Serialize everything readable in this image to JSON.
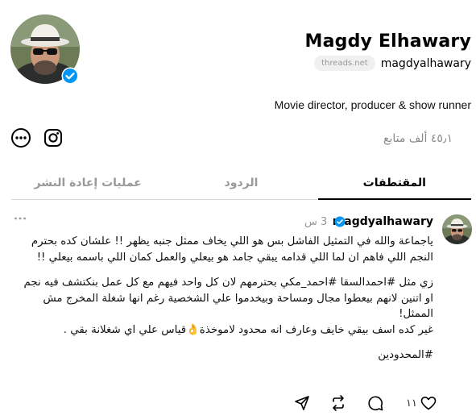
{
  "profile": {
    "name": "Magdy Elhawary",
    "handle": "magdyalhawary",
    "domain_pill": "threads.net",
    "bio": "Movie director, producer & show runner",
    "followers": "٤٥٫١ ألف متابع"
  },
  "tabs": [
    {
      "label": "المقتطفات",
      "active": true
    },
    {
      "label": "الردود",
      "active": false
    },
    {
      "label": "عمليات إعادة النشر",
      "active": false
    }
  ],
  "post": {
    "username": "magdyalhawary",
    "time": "3 س",
    "paragraph_1": "ياجماعة والله في التمثيل الفاشل بس هو اللي يخاف ممثل جنبه يظهر !! علشان كده بحترم النجم اللي فاهم ان لما اللي قدامه يبقي جامد هو بيعلي والعمل كمان اللي باسمه بيعلي !!",
    "paragraph_2": "زي مثل #احمدالسقا #احمد_مكي بحترمهم لان كل واحد فيهم مع كل عمل بنكتشف فيه نجم او اتنين لانهم بيعطوا مجال ومساحة وبيخدموا علي الشخصية رغم انها شغلة المخرج مش الممثل!\nغير كده اسف بيقي خايف وعارف انه محدود لاموخذة👌قياس علي اي شغلانة بقي .",
    "paragraph_3": "#المحدودين",
    "likes": "١١"
  },
  "icons": {
    "threads": "at-sign-icon",
    "instagram": "instagram-icon",
    "more": "more-horizontal-icon",
    "like": "heart-icon",
    "reply": "comment-icon",
    "repost": "repost-icon",
    "share": "send-icon",
    "verified": "verified-badge-icon"
  },
  "colors": {
    "verified": "#0095f6",
    "muted": "#999999",
    "divider": "#d9d9d9"
  }
}
